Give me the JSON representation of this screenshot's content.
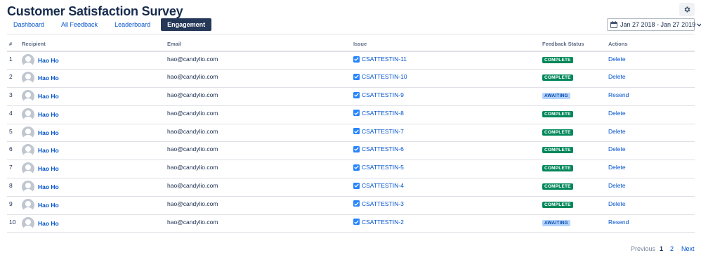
{
  "header": {
    "title": "Customer Satisfaction Survey"
  },
  "settings": {
    "icon": "gear-icon"
  },
  "tabs": [
    {
      "label": "Dashboard",
      "active": false
    },
    {
      "label": "All Feedback",
      "active": false
    },
    {
      "label": "Leaderboard",
      "active": false
    },
    {
      "label": "Engagement",
      "active": true
    }
  ],
  "date_range": {
    "label": "Jan 27 2018 - Jan 27 2019",
    "icon": "calendar-icon"
  },
  "table": {
    "columns": [
      "#",
      "Recipient",
      "Email",
      "Issue",
      "Feedback Status",
      "Actions"
    ],
    "rows": [
      {
        "num": "1",
        "recipient": "Hao Ho",
        "email": "hao@candylio.com",
        "issue": "CSATTESTIN-11",
        "status": "COMPLETE",
        "action": "Delete"
      },
      {
        "num": "2",
        "recipient": "Hao Ho",
        "email": "hao@candylio.com",
        "issue": "CSATTESTIN-10",
        "status": "COMPLETE",
        "action": "Delete"
      },
      {
        "num": "3",
        "recipient": "Hao Ho",
        "email": "hao@candylio.com",
        "issue": "CSATTESTIN-9",
        "status": "AWAITING",
        "action": "Resend"
      },
      {
        "num": "4",
        "recipient": "Hao Ho",
        "email": "hao@candylio.com",
        "issue": "CSATTESTIN-8",
        "status": "COMPLETE",
        "action": "Delete"
      },
      {
        "num": "5",
        "recipient": "Hao Ho",
        "email": "hao@candylio.com",
        "issue": "CSATTESTIN-7",
        "status": "COMPLETE",
        "action": "Delete"
      },
      {
        "num": "6",
        "recipient": "Hao Ho",
        "email": "hao@candylio.com",
        "issue": "CSATTESTIN-6",
        "status": "COMPLETE",
        "action": "Delete"
      },
      {
        "num": "7",
        "recipient": "Hao Ho",
        "email": "hao@candylio.com",
        "issue": "CSATTESTIN-5",
        "status": "COMPLETE",
        "action": "Delete"
      },
      {
        "num": "8",
        "recipient": "Hao Ho",
        "email": "hao@candylio.com",
        "issue": "CSATTESTIN-4",
        "status": "COMPLETE",
        "action": "Delete"
      },
      {
        "num": "9",
        "recipient": "Hao Ho",
        "email": "hao@candylio.com",
        "issue": "CSATTESTIN-3",
        "status": "COMPLETE",
        "action": "Delete"
      },
      {
        "num": "10",
        "recipient": "Hao Ho",
        "email": "hao@candylio.com",
        "issue": "CSATTESTIN-2",
        "status": "AWAITING",
        "action": "Resend"
      }
    ]
  },
  "pagination": {
    "previous": "Previous",
    "page1": "1",
    "page2": "2",
    "next": "Next",
    "current": "1"
  },
  "colors": {
    "brand_link": "#0052cc",
    "active_tab": "#253858",
    "complete": "#00875a",
    "awaiting_bg": "#b3d4ff",
    "awaiting_text": "#0747a6"
  }
}
